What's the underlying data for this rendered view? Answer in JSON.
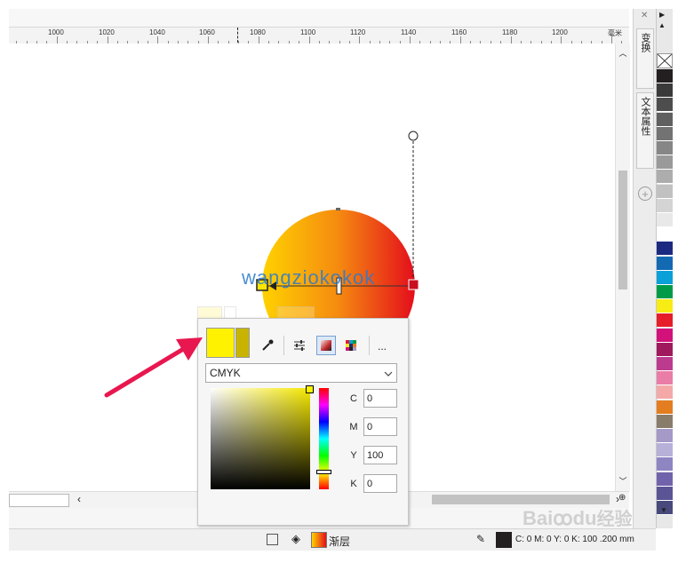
{
  "ruler": {
    "labels": [
      "1000",
      "1020",
      "1040",
      "1060",
      "1080",
      "1100",
      "1120",
      "1140",
      "1160",
      "1180",
      "1200"
    ],
    "unit": "毫米"
  },
  "canvas": {
    "watermark": "wangziokokok",
    "gradient_start": "#ffd400",
    "gradient_end": "#e8101a"
  },
  "docker": {
    "tabs": [
      "变换",
      "文本属性"
    ]
  },
  "palette": {
    "colors": [
      "#231f20",
      "#3a3a3a",
      "#4d4d4d",
      "#606060",
      "#737373",
      "#868686",
      "#9a9a9a",
      "#adadad",
      "#c1c1c1",
      "#d4d4d4",
      "#e8e8e8",
      "#ffffff",
      "#1b2a80",
      "#1469b3",
      "#0aa0d8",
      "#009b48",
      "#f7ec13",
      "#e51e2a",
      "#d2127a",
      "#a0195e",
      "#bc3b8f",
      "#e97da7",
      "#f4a9a8",
      "#e37d1f",
      "#8a7c6a",
      "#a499c7",
      "#b7b0d8",
      "#8e85c3",
      "#7163ab",
      "#5b5495",
      "#474a7a"
    ]
  },
  "popup": {
    "mode": "CMYK",
    "fields": [
      {
        "label": "C",
        "value": "0"
      },
      {
        "label": "M",
        "value": "0"
      },
      {
        "label": "Y",
        "value": "100"
      },
      {
        "label": "K",
        "value": "0"
      }
    ],
    "current_color": "#fff200",
    "previous_color": "#c8b400",
    "more_label": "..."
  },
  "status": {
    "fill_label": "渐层",
    "outline_text": "C: 0 M: 0 Y: 0 K: 100 .200 mm"
  },
  "baidu": {
    "text": "Bai",
    "text2": "du",
    "text3": "经验"
  }
}
